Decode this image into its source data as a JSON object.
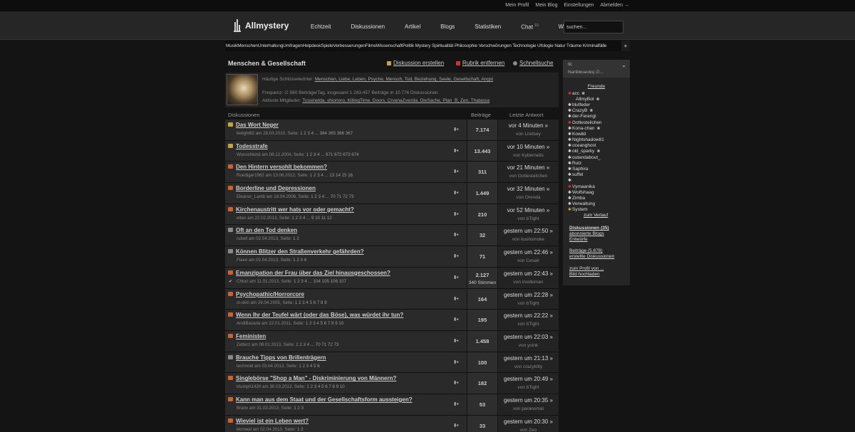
{
  "topbar": {
    "links": [
      "Mein Profil",
      "Mein Blog",
      "Einstellungen",
      "Abmelden →"
    ]
  },
  "header": {
    "title": "Allmystery",
    "nav": [
      {
        "label": "Echtzeit"
      },
      {
        "label": "Diskussionen"
      },
      {
        "label": "Artikel"
      },
      {
        "label": "Blogs"
      },
      {
        "label": "Statistiken"
      },
      {
        "label": "Chat",
        "badge": "10"
      },
      {
        "label": "Wiki"
      }
    ],
    "search_placeholder": "suchen..."
  },
  "categories": [
    "Musik",
    "Menschen",
    "Unterhaltung",
    "Umfragen",
    "Helpdesk",
    "Spiele",
    "Verbesserungen",
    "Filme",
    "Wissenschaft",
    "Politik",
    "Mystery",
    "Spiritualität",
    "Philosophie",
    "Verschwörungen",
    "Technologie",
    "Ufologie",
    "Natur",
    "Träume",
    "Kriminalfälle"
  ],
  "categories_text": "MusikMenschenUnterhaltungUmfragenHelpdeskSpieleVerbesserungenFilmeWissenschaftPolitik Mystery Spiritualität Philosophie Verschwörungen Technologie Ufologie Natur Träume Kriminalfälle",
  "page": {
    "title": "Menschen & Gesellschaft",
    "actions": {
      "create": "Diskussion erstellen",
      "remove": "Rubrik entfernen",
      "search": "Schnellsuche"
    },
    "info": {
      "keywords_label": "Häufige Schlüsselwörter:",
      "keywords": "Menschen, Liebe, Leben, Psyche, Mensch, Tod, Beziehung, Seele, Gesellschaft, Angst",
      "freq": "Frequenz: ∅ 560 Beiträge/Tag, insgesamt 1.283.457 Beiträge in 10.776 Diskussionen",
      "active_label": "Aktivste Mitglieder:",
      "active": "Tussinelda, shionoro, KillingTime, Doors, CrvenaZvezda, DieSache, Plan_B, Zeo, Thalassa"
    }
  },
  "table": {
    "headers": {
      "topic": "Diskussionen",
      "count": "Beiträge",
      "last": "Letzte Antwort"
    },
    "rows": [
      {
        "title": "Das Wort Neger",
        "author": "belight82",
        "date": "am 28.03.2010, Seite:",
        "pages": "1 2 3 4 ... 364 365 366 367",
        "count": "7.174",
        "when": "vor 4 Minuten »",
        "by": "Lindsey",
        "icon": "#c9a33a"
      },
      {
        "title": "Todesstrafe",
        "author": "Wunschkind",
        "date": "am 08.12.2004, Seite:",
        "pages": "1 2 3 4 ... 671 672 673 674",
        "count": "13.443",
        "when": "vor 10 Minuten »",
        "by": "Kybernetis",
        "icon": "#c9a33a"
      },
      {
        "title": "Den Hintern versohlt bekommen?",
        "author": "Ruediger1962",
        "date": "am 13.06.2012, Seite:",
        "pages": "1 2 3 4 ... 13 14 15 16",
        "count": "311",
        "when": "vor 21 Minuten »",
        "by": "Gottesteilchen",
        "icon": "#d2602a"
      },
      {
        "title": "Borderline und Depressionen",
        "author": "Eleanor_Lamb",
        "date": "am 18.04.2006, Seite:",
        "pages": "1 2 3 4 ... 70 71 72 73",
        "count": "1.449",
        "when": "vor 32 Minuten »",
        "by": "Orenda",
        "icon": "#d2602a"
      },
      {
        "title": "Kirchenaustritt wer hats vor oder gemacht?",
        "author": "elten",
        "date": "am 22.02.2013, Seite:",
        "pages": "1 2 3 4 ... 9 10 11 12",
        "count": "210",
        "when": "vor 52 Minuten »",
        "by": "bTight",
        "icon": "#d2602a"
      },
      {
        "title": "Oft an den Tod denken",
        "author": "rubell",
        "date": "am 02.04.2013, Seite:",
        "pages": "1 2",
        "count": "32",
        "when": "gestern um 22:50 »",
        "by": "kushsmoke",
        "icon": "#8a8a8a"
      },
      {
        "title": "Können Blitzer den Straßenverkehr gefährden?",
        "author": "Flave",
        "date": "am 02.04.2013, Seite:",
        "pages": "1 2 3 4",
        "count": "71",
        "when": "gestern um 22:46 »",
        "by": "Cesair",
        "icon": "#8a8a8a"
      },
      {
        "title": "Emanzipation der Frau über das Ziel hinausgeschossen?",
        "author": "Chtun",
        "date": "am 11.01.2013, Seite:",
        "pages": "1 2 3 4 ... 104 105 106 107",
        "count": "2.127",
        "votes": "340 Stimmen",
        "when": "gestern um 22:43 »",
        "by": "insideman",
        "icon": "#d2602a",
        "poll": true
      },
      {
        "title": "Psychopathic/Horrorcore",
        "author": "oi-skin",
        "date": "am 29.04.2005, Seite:",
        "pages": "1 2 3 4 5 6 7 8 9",
        "count": "164",
        "when": "gestern um 22:28 »",
        "by": "bTight",
        "icon": "#d2602a"
      },
      {
        "title": "Wenn Ihr der Teufel wärt (oder das Böse), was würdet ihr tun?",
        "author": "AndiBavaria",
        "date": "am 22.01.2011, Seite:",
        "pages": "1 2 3 4 5 6 7 8 9 10",
        "count": "195",
        "when": "gestern um 22:22 »",
        "by": "bTight",
        "icon": "#d2602a"
      },
      {
        "title": "Feministen",
        "author": "Zetterz",
        "date": "am 08.01.2013, Seite:",
        "pages": "1 2 3 4 ... 70 71 72 73",
        "count": "1.458",
        "when": "gestern um 22:03 »",
        "by": "yoink",
        "icon": "#d2602a"
      },
      {
        "title": "Brauche Tipps von Brillenträgern",
        "author": "technoid",
        "date": "am 03.04.2013, Seite:",
        "pages": "1 2 3 4 5 6",
        "count": "100",
        "when": "gestern um 21:13 »",
        "by": "crazykitty",
        "icon": "#8a8a8a"
      },
      {
        "title": "Singlebörse \"Shop a Man\" - Diskriminierung von Männern?",
        "author": "triumph1420",
        "date": "am 30.03.2013, Seite:",
        "pages": "1 2 3 4 5 6 7 8 9 10",
        "count": "182",
        "when": "gestern um 20:49 »",
        "by": "bTight",
        "icon": "#d2602a"
      },
      {
        "title": "Kann man aus dem Staat und der Gesellschaftsform aussteigen?",
        "author": "Branx",
        "date": "am 31.03.2013, Seite:",
        "pages": "1 2 3",
        "count": "53",
        "when": "gestern um 20:35 »",
        "by": "paranomal",
        "icon": "#d2602a"
      },
      {
        "title": "Wieviel ist ein Leben wert?",
        "author": "kkrowal",
        "date": "am 02.04.2013, Seite:",
        "pages": "1 2",
        "count": "33",
        "when": "gestern um 20:30 »",
        "by": "Zeo",
        "icon": "#d2602a"
      }
    ]
  },
  "sidebar": {
    "header_line1": "tic",
    "header_line2": "Nǝnbɐuǝuɐɥ ∅...",
    "friends_label": "Freunde",
    "friends": [
      {
        "name": "acc",
        "mark": "#d33",
        "extra": "❀"
      },
      {
        "name": "AllmyBot",
        "mark": "",
        "extra": "❀"
      },
      {
        "name": "blutfeder",
        "mark": "#ddd",
        "extra": ""
      },
      {
        "name": "CrazyB",
        "mark": "#ddd",
        "extra": "❀"
      },
      {
        "name": "der-Ferengi",
        "mark": "#ddd",
        "extra": ""
      },
      {
        "name": "Gottesteilchen",
        "mark": "#d33",
        "extra": ""
      },
      {
        "name": "Kona-chan",
        "mark": "#ddd",
        "extra": "❀"
      },
      {
        "name": "Kowild",
        "mark": "#ddd",
        "extra": ""
      },
      {
        "name": "Nightshadow81",
        "mark": "#ddd",
        "extra": ""
      },
      {
        "name": "oceanghost",
        "mark": "#ddd",
        "extra": ""
      },
      {
        "name": "old_sparky",
        "mark": "#ddd",
        "extra": "❀"
      },
      {
        "name": "outandabout_",
        "mark": "#ddd",
        "extra": ""
      },
      {
        "name": "Rutz",
        "mark": "#ddd",
        "extra": ""
      },
      {
        "name": "Saphira",
        "mark": "#ddd",
        "extra": ""
      },
      {
        "name": "suffel",
        "mark": "#ddd",
        "extra": ""
      },
      {
        "name": "",
        "mark": "#ddd",
        "extra": ""
      },
      {
        "name": "Vymaanika",
        "mark": "#d33",
        "extra": ""
      },
      {
        "name": "Wolfshaag",
        "mark": "#ddd",
        "extra": ""
      },
      {
        "name": "Zimba",
        "mark": "#ddd",
        "extra": ""
      },
      {
        "name": "Verwaltung",
        "mark": "#ddd",
        "extra": ""
      },
      {
        "name": "System",
        "mark": "#c9a33a",
        "extra": ""
      }
    ],
    "history_link": "zum Verlauf",
    "links_group1": [
      "Diskussionen (35)",
      "abonnierte Blogs",
      "Entwürfe"
    ],
    "links_group2": [
      "Beiträge (5.678)",
      "erstellte Diskussionen"
    ],
    "links_group3": [
      "zum Profil von ...",
      "Bild hochladen"
    ]
  }
}
